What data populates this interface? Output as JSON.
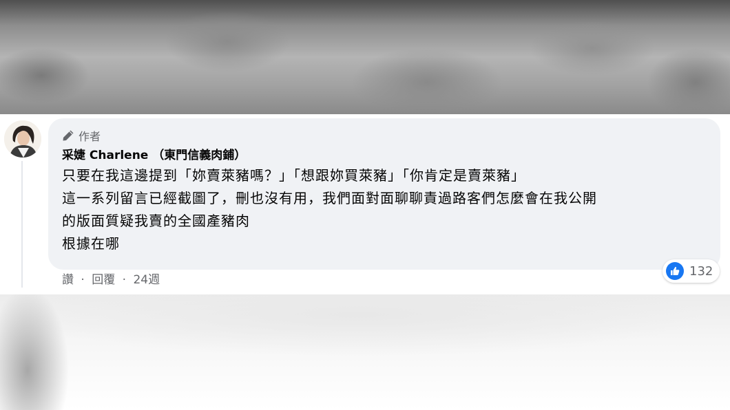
{
  "comment": {
    "author_badge": "作者",
    "author_name": "采婕 Charlene （東門信義肉鋪）",
    "body_lines": [
      "只要在我這邊提到「妳賣萊豬嗎？」「想跟妳買萊豬」「你肯定是賣萊豬」",
      "這一系列留言已經截圖了，刪也沒有用，我們面對面聊聊責過路客們怎麼會在我公開",
      "的版面質疑我賣的全國產豬肉",
      "根據在哪"
    ],
    "reactions": {
      "icon": "thumbs-up-icon",
      "count": "132"
    },
    "actions": {
      "like_label": "讚",
      "separator": "·",
      "reply_label": "回覆",
      "time_label": "24週"
    }
  },
  "colors": {
    "bubble_bg": "#f0f2f5",
    "text_primary": "#050505",
    "text_secondary": "#65676b",
    "like_blue": "#1877f2"
  }
}
